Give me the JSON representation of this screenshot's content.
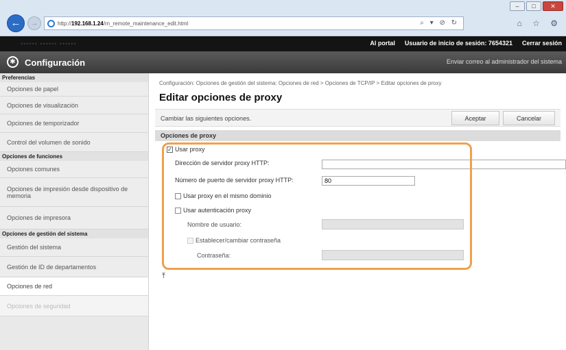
{
  "browser": {
    "url_prefix": "http://",
    "url_host": "192.168.1.24",
    "url_path": "/rn_remote_maintenance_edit.html",
    "toolbar_glyphs": "⌕ ▾ ⊘ ↻",
    "right_icons": "⌂ ☆ ⚙",
    "window_buttons": [
      "–",
      "□",
      "✕"
    ],
    "accent": "#2a6cc6"
  },
  "portal": {
    "left_text": "••••••   •••••• ••••••",
    "links": [
      "Al portal",
      "Usuario de inicio de sesión:  7654321",
      "Cerrar sesión"
    ]
  },
  "header": {
    "title": "Configuración",
    "mail_link": "Enviar correo al administrador del sistema"
  },
  "sidebar": {
    "sections": [
      {
        "heading": "Preferencias",
        "items": [
          "Opciones de papel",
          "Opciones de visualización",
          "Opciones de temporizador",
          "Control del volumen de sonido"
        ]
      },
      {
        "heading": "Opciones de funciones",
        "items": [
          "Opciones comunes",
          "Opciones de impresión desde dispositivo de memoria",
          "Opciones de impresora"
        ]
      },
      {
        "heading": "Opciones de gestión del sistema",
        "items": [
          "Gestión del sistema",
          "Gestión de ID de departamentos",
          "Opciones de red",
          "Opciones de seguridad"
        ]
      }
    ]
  },
  "main": {
    "breadcrumb": "Configuración: Opciones de gestión del sistema: Opciones de red > Opciones de TCP/IP > Editar opciones de proxy",
    "title": "Editar opciones de proxy",
    "instruction": "Cambiar las siguientes opciones.",
    "accept_label": "Aceptar",
    "cancel_label": "Cancelar",
    "section_title": "Opciones de proxy",
    "use_proxy": {
      "label": "Usar proxy",
      "checked": true
    },
    "http_address": {
      "label": "Dirección de servidor proxy HTTP:",
      "value": ""
    },
    "http_port": {
      "label": "Número de puerto de servidor proxy HTTP:",
      "value": "80"
    },
    "same_domain": {
      "label": "Usar proxy en el mismo dominio",
      "checked": false
    },
    "use_auth": {
      "label": "Usar autenticación proxy",
      "checked": false
    },
    "username": {
      "label": "Nombre de usuario:",
      "value": ""
    },
    "set_password": {
      "label": "Establecer/cambiar contraseña",
      "checked": false
    },
    "password": {
      "label": "Contraseña:",
      "value": ""
    },
    "back_to_top": "⤒",
    "highlight_color": "#f0a04b"
  }
}
